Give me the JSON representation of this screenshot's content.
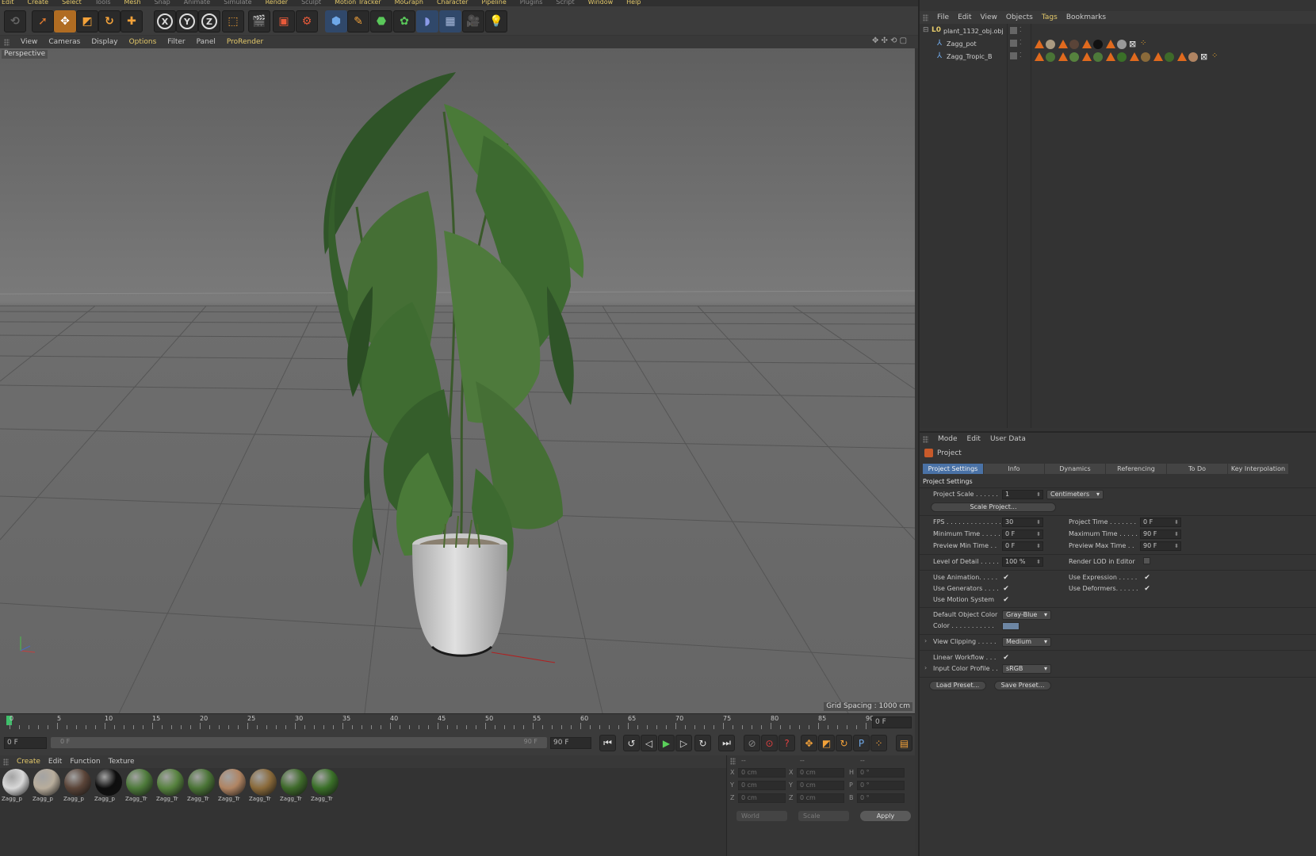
{
  "main_menu": [
    "Edit",
    "Create",
    "Select",
    "Tools",
    "Mesh",
    "Snap",
    "Animate",
    "Simulate",
    "Render",
    "Sculpt",
    "Motion Tracker",
    "MoGraph",
    "Character",
    "Pipeline",
    "Plugins",
    "Script",
    "Window",
    "Help"
  ],
  "toolbar": {
    "axis_x": "X",
    "axis_y": "Y",
    "axis_z": "Z"
  },
  "viewport_menu": [
    "View",
    "Cameras",
    "Display",
    "Options",
    "Filter",
    "Panel",
    "ProRender"
  ],
  "viewport": {
    "label": "Perspective",
    "grid_spacing": "Grid Spacing : 1000 cm"
  },
  "timeline": {
    "ticks": [
      "0",
      "5",
      "10",
      "15",
      "20",
      "25",
      "30",
      "35",
      "40",
      "45",
      "50",
      "55",
      "60",
      "65",
      "70",
      "75",
      "80",
      "85",
      "90"
    ],
    "current_frame": "0 F",
    "start_frame": "0 F",
    "range_start": "0 F",
    "range_end": "90 F",
    "end_frame": "90 F"
  },
  "material_menu": [
    "Create",
    "Edit",
    "Function",
    "Texture"
  ],
  "materials": [
    {
      "label": "Zagg_p",
      "color": "#d8d8d8"
    },
    {
      "label": "Zagg_p",
      "color": "#b8ad9c"
    },
    {
      "label": "Zagg_p",
      "color": "#5a4438"
    },
    {
      "label": "Zagg_p",
      "color": "#0e0e0e"
    },
    {
      "label": "Zagg_Tr",
      "color": "#4d7a3a"
    },
    {
      "label": "Zagg_Tr",
      "color": "#56823e"
    },
    {
      "label": "Zagg_Tr",
      "color": "#4a7436"
    },
    {
      "label": "Zagg_Tr",
      "color": "#b08462"
    },
    {
      "label": "Zagg_Tr",
      "color": "#8a6a3a"
    },
    {
      "label": "Zagg_Tr",
      "color": "#3e6a2a"
    },
    {
      "label": "Zagg_Tr",
      "color": "#3a7028"
    }
  ],
  "coords": {
    "header": [
      "--",
      "--",
      "--"
    ],
    "rows": [
      {
        "a": "X",
        "av": "0 cm",
        "b": "X",
        "bv": "0 cm",
        "c": "H",
        "cv": "0 °"
      },
      {
        "a": "Y",
        "av": "0 cm",
        "b": "Y",
        "bv": "0 cm",
        "c": "P",
        "cv": "0 °"
      },
      {
        "a": "Z",
        "av": "0 cm",
        "b": "Z",
        "bv": "0 cm",
        "c": "B",
        "cv": "0 °"
      }
    ],
    "mode": "World",
    "size_mode": "Scale",
    "apply": "Apply"
  },
  "object_manager": {
    "menu": [
      "File",
      "Edit",
      "View",
      "Objects",
      "Tags",
      "Bookmarks"
    ],
    "objects": [
      {
        "name": "plant_1132_obj.obj",
        "level": 0
      },
      {
        "name": "Zagg_pot",
        "level": 1
      },
      {
        "name": "Zagg_Tropic_B",
        "level": 1
      }
    ]
  },
  "attributes": {
    "menu": [
      "Mode",
      "Edit",
      "User Data"
    ],
    "title": "Project",
    "tabs": [
      "Project Settings",
      "Info",
      "Dynamics",
      "Referencing",
      "To Do",
      "Key Interpolation"
    ],
    "section": "Project Settings",
    "project_scale_label": "Project Scale . . . . . .",
    "project_scale": "1",
    "scale_unit": "Centimeters",
    "scale_project_btn": "Scale Project...",
    "fps_label": "FPS . . . . . . . . . . . . . .",
    "fps": "30",
    "project_time_label": "Project Time . . . . . . .",
    "project_time": "0 F",
    "min_time_label": "Minimum Time . . . . .",
    "min_time": "0 F",
    "max_time_label": "Maximum Time . . . . .",
    "max_time": "90 F",
    "prev_min_label": "Preview Min Time . .",
    "prev_min": "0 F",
    "prev_max_label": "Preview Max Time . .",
    "prev_max": "90 F",
    "lod_label": "Level of Detail . . . . .",
    "lod": "100 %",
    "render_lod_label": "Render LOD in Editor",
    "use_animation": "Use Animation. . . . .",
    "use_expression": "Use Expression . . . . .",
    "use_generators": "Use Generators . . . .",
    "use_deformers": "Use Deformers. . . . . .",
    "use_motion": "Use Motion System",
    "default_color_label": "Default Object Color",
    "default_color": "Gray-Blue",
    "color_label": "Color . . . . . . . . . . .",
    "color_swatch": "#6d86a4",
    "view_clipping_label": "View Clipping . . . . .",
    "view_clipping": "Medium",
    "linear_workflow": "Linear Workflow . . .",
    "input_profile_label": "Input Color Profile . .",
    "input_profile": "sRGB",
    "load_preset": "Load Preset...",
    "save_preset": "Save Preset...",
    "check": "✔"
  },
  "colors": {
    "accent": "#e4c96a",
    "tab_active": "#4a72a6",
    "plant_dark": "#2f5428",
    "plant_light": "#4e7a3c",
    "pot": "#d2d2d2"
  }
}
